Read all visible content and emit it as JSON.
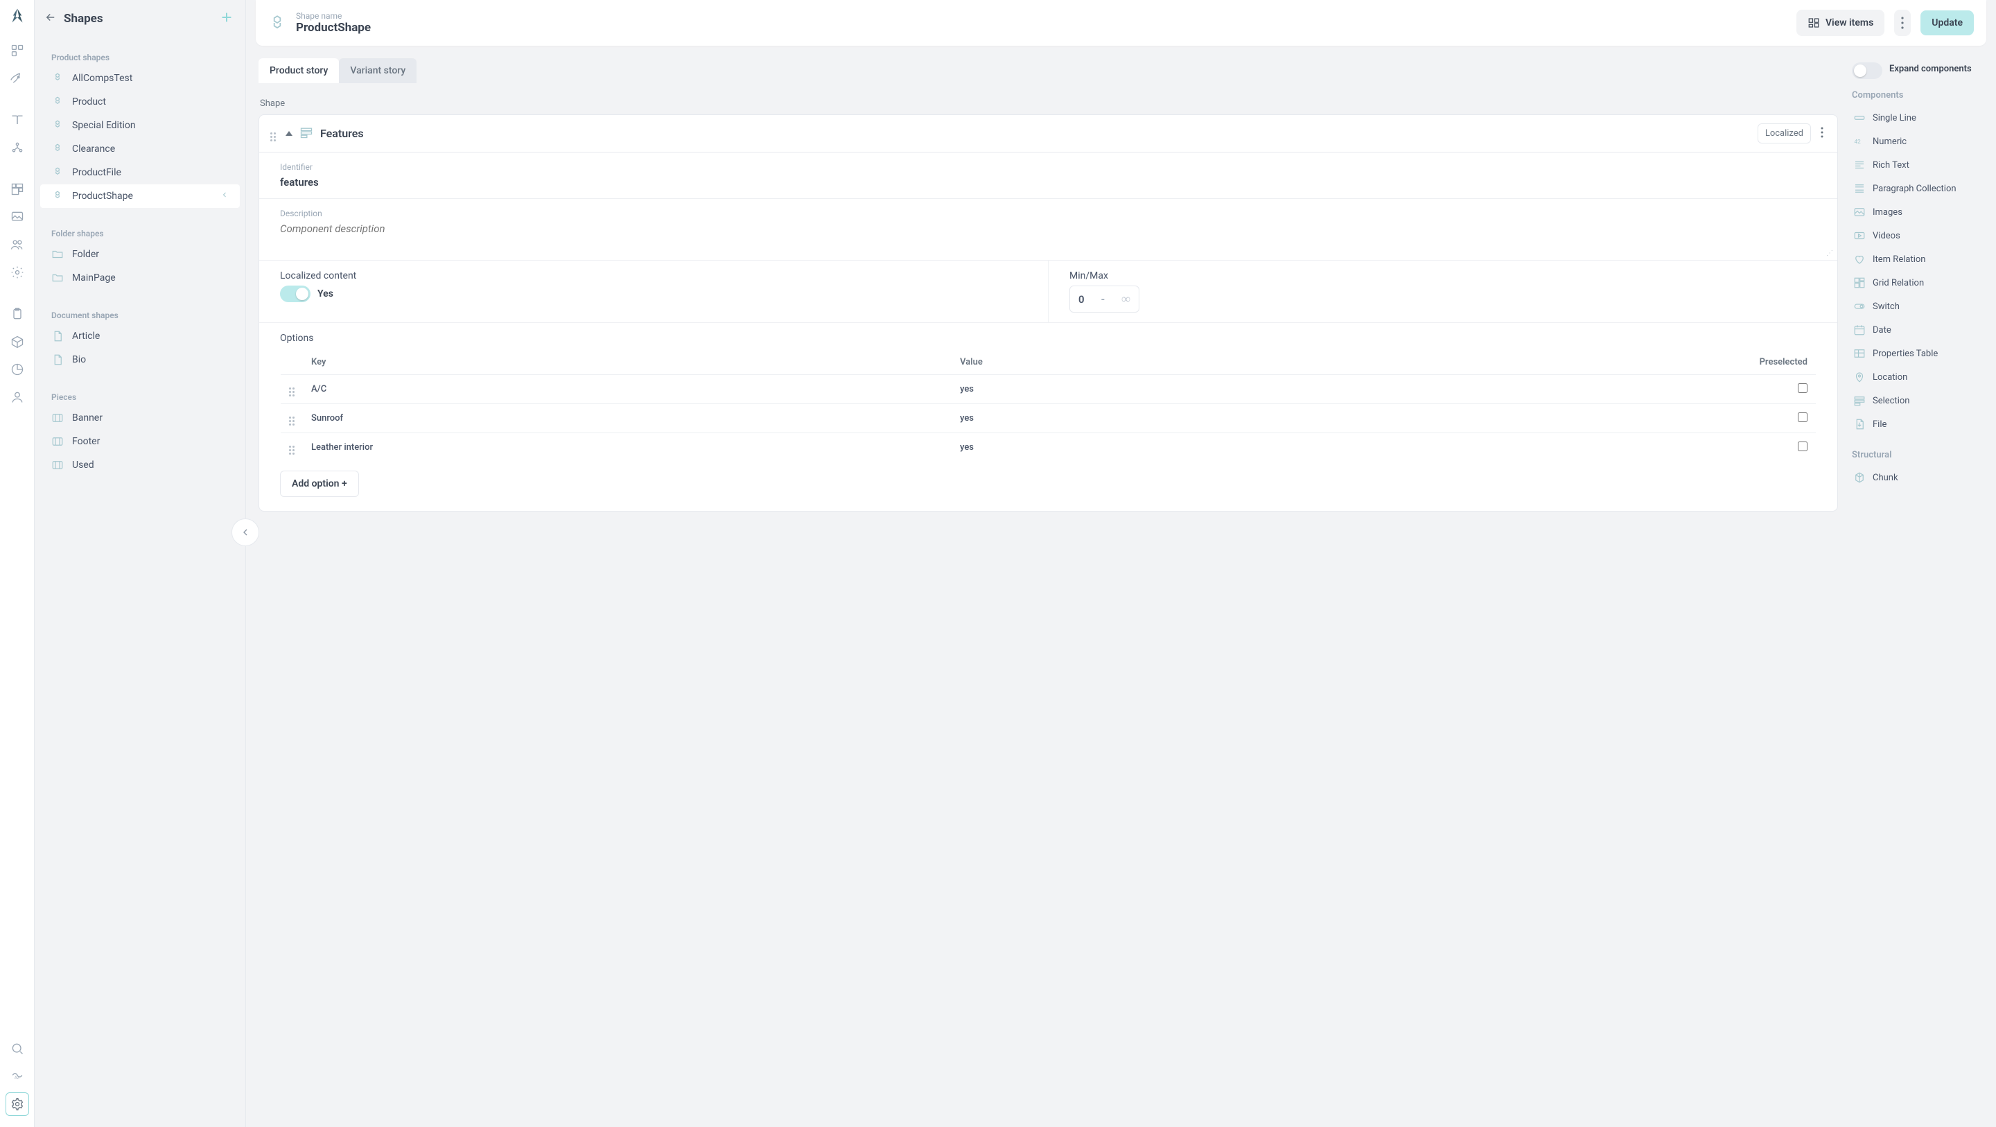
{
  "sidebar": {
    "title": "Shapes",
    "sections": [
      {
        "title": "Product shapes",
        "items": [
          "AllCompsTest",
          "Product",
          "Special Edition",
          "Clearance",
          "ProductFile",
          "ProductShape"
        ]
      },
      {
        "title": "Folder shapes",
        "items": [
          "Folder",
          "MainPage"
        ]
      },
      {
        "title": "Document shapes",
        "items": [
          "Article",
          "Bio"
        ]
      },
      {
        "title": "Pieces",
        "items": [
          "Banner",
          "Footer",
          "Used"
        ]
      }
    ]
  },
  "header": {
    "eyebrow": "Shape name",
    "name": "ProductShape",
    "view_items": "View items",
    "update": "Update"
  },
  "tabs": {
    "product": "Product story",
    "variant": "Variant story"
  },
  "shape_label": "Shape",
  "component": {
    "name": "Features",
    "chip": "Localized",
    "identifier_label": "Identifier",
    "identifier": "features",
    "description_label": "Description",
    "description_placeholder": "Component description",
    "localized_label": "Localized content",
    "localized_value": "Yes",
    "minmax_label": "Min/Max",
    "min": "0",
    "max": "∞",
    "options_label": "Options",
    "table_head": {
      "key": "Key",
      "value": "Value",
      "preselected": "Preselected"
    },
    "rows": [
      {
        "key": "A/C",
        "value": "yes"
      },
      {
        "key": "Sunroof",
        "value": "yes"
      },
      {
        "key": "Leather interior",
        "value": "yes"
      }
    ],
    "add_option": "Add option +"
  },
  "right": {
    "expand": "Expand components",
    "components_title": "Components",
    "components": [
      "Single Line",
      "Numeric",
      "Rich Text",
      "Paragraph Collection",
      "Images",
      "Videos",
      "Item Relation",
      "Grid Relation",
      "Switch",
      "Date",
      "Properties Table",
      "Location",
      "Selection",
      "File"
    ],
    "structural_title": "Structural",
    "structural": [
      "Chunk"
    ]
  }
}
